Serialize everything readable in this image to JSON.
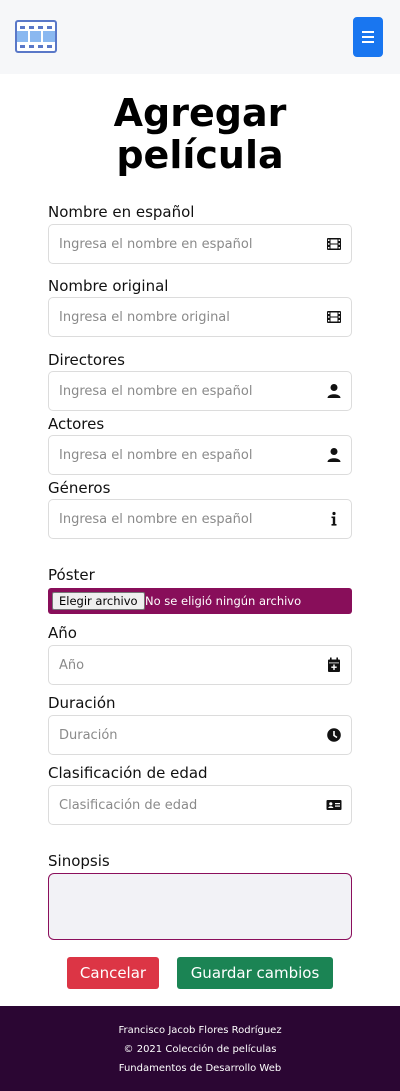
{
  "navbar": {
    "logo_icon": "film-logo-icon",
    "menu_icon": "hamburger-menu-icon",
    "menu_color": "#1976f0"
  },
  "page": {
    "title_line1": "Agregar",
    "title_line2": "película"
  },
  "form": {
    "nombre_espanol": {
      "label": "Nombre en español",
      "placeholder": "Ingresa el nombre en español",
      "icon": "film-icon"
    },
    "nombre_original": {
      "label": "Nombre original",
      "placeholder": "Ingresa el nombre original",
      "icon": "film-icon"
    },
    "directores": {
      "label": "Directores",
      "placeholder": "Ingresa el nombre en español",
      "icon": "person-icon"
    },
    "actores": {
      "label": "Actores",
      "placeholder": "Ingresa el nombre en español",
      "icon": "person-icon"
    },
    "generos": {
      "label": "Géneros",
      "placeholder": "Ingresa el nombre en español",
      "icon": "info-icon"
    },
    "poster": {
      "label": "Póster",
      "button_label": "Elegir archivo",
      "status": "No se eligió ningún archivo",
      "color": "#880e5a"
    },
    "anio": {
      "label": "Año",
      "placeholder": "Año",
      "icon": "calendar-plus-icon"
    },
    "duracion": {
      "label": "Duración",
      "placeholder": "Duración",
      "icon": "clock-icon"
    },
    "clasificacion": {
      "label": "Clasificación de edad",
      "placeholder": "Clasificación de edad",
      "icon": "id-card-icon"
    },
    "sinopsis": {
      "label": "Sinopsis",
      "value": ""
    }
  },
  "actions": {
    "cancel_label": "Cancelar",
    "cancel_color": "#dc3545",
    "save_label": "Guardar cambios",
    "save_color": "#1b8454"
  },
  "footer": {
    "author": "Francisco Jacob Flores Rodríguez",
    "copyright": "© 2021 Colección de películas",
    "course": "Fundamentos de Desarrollo Web",
    "background": "#2b0633"
  }
}
